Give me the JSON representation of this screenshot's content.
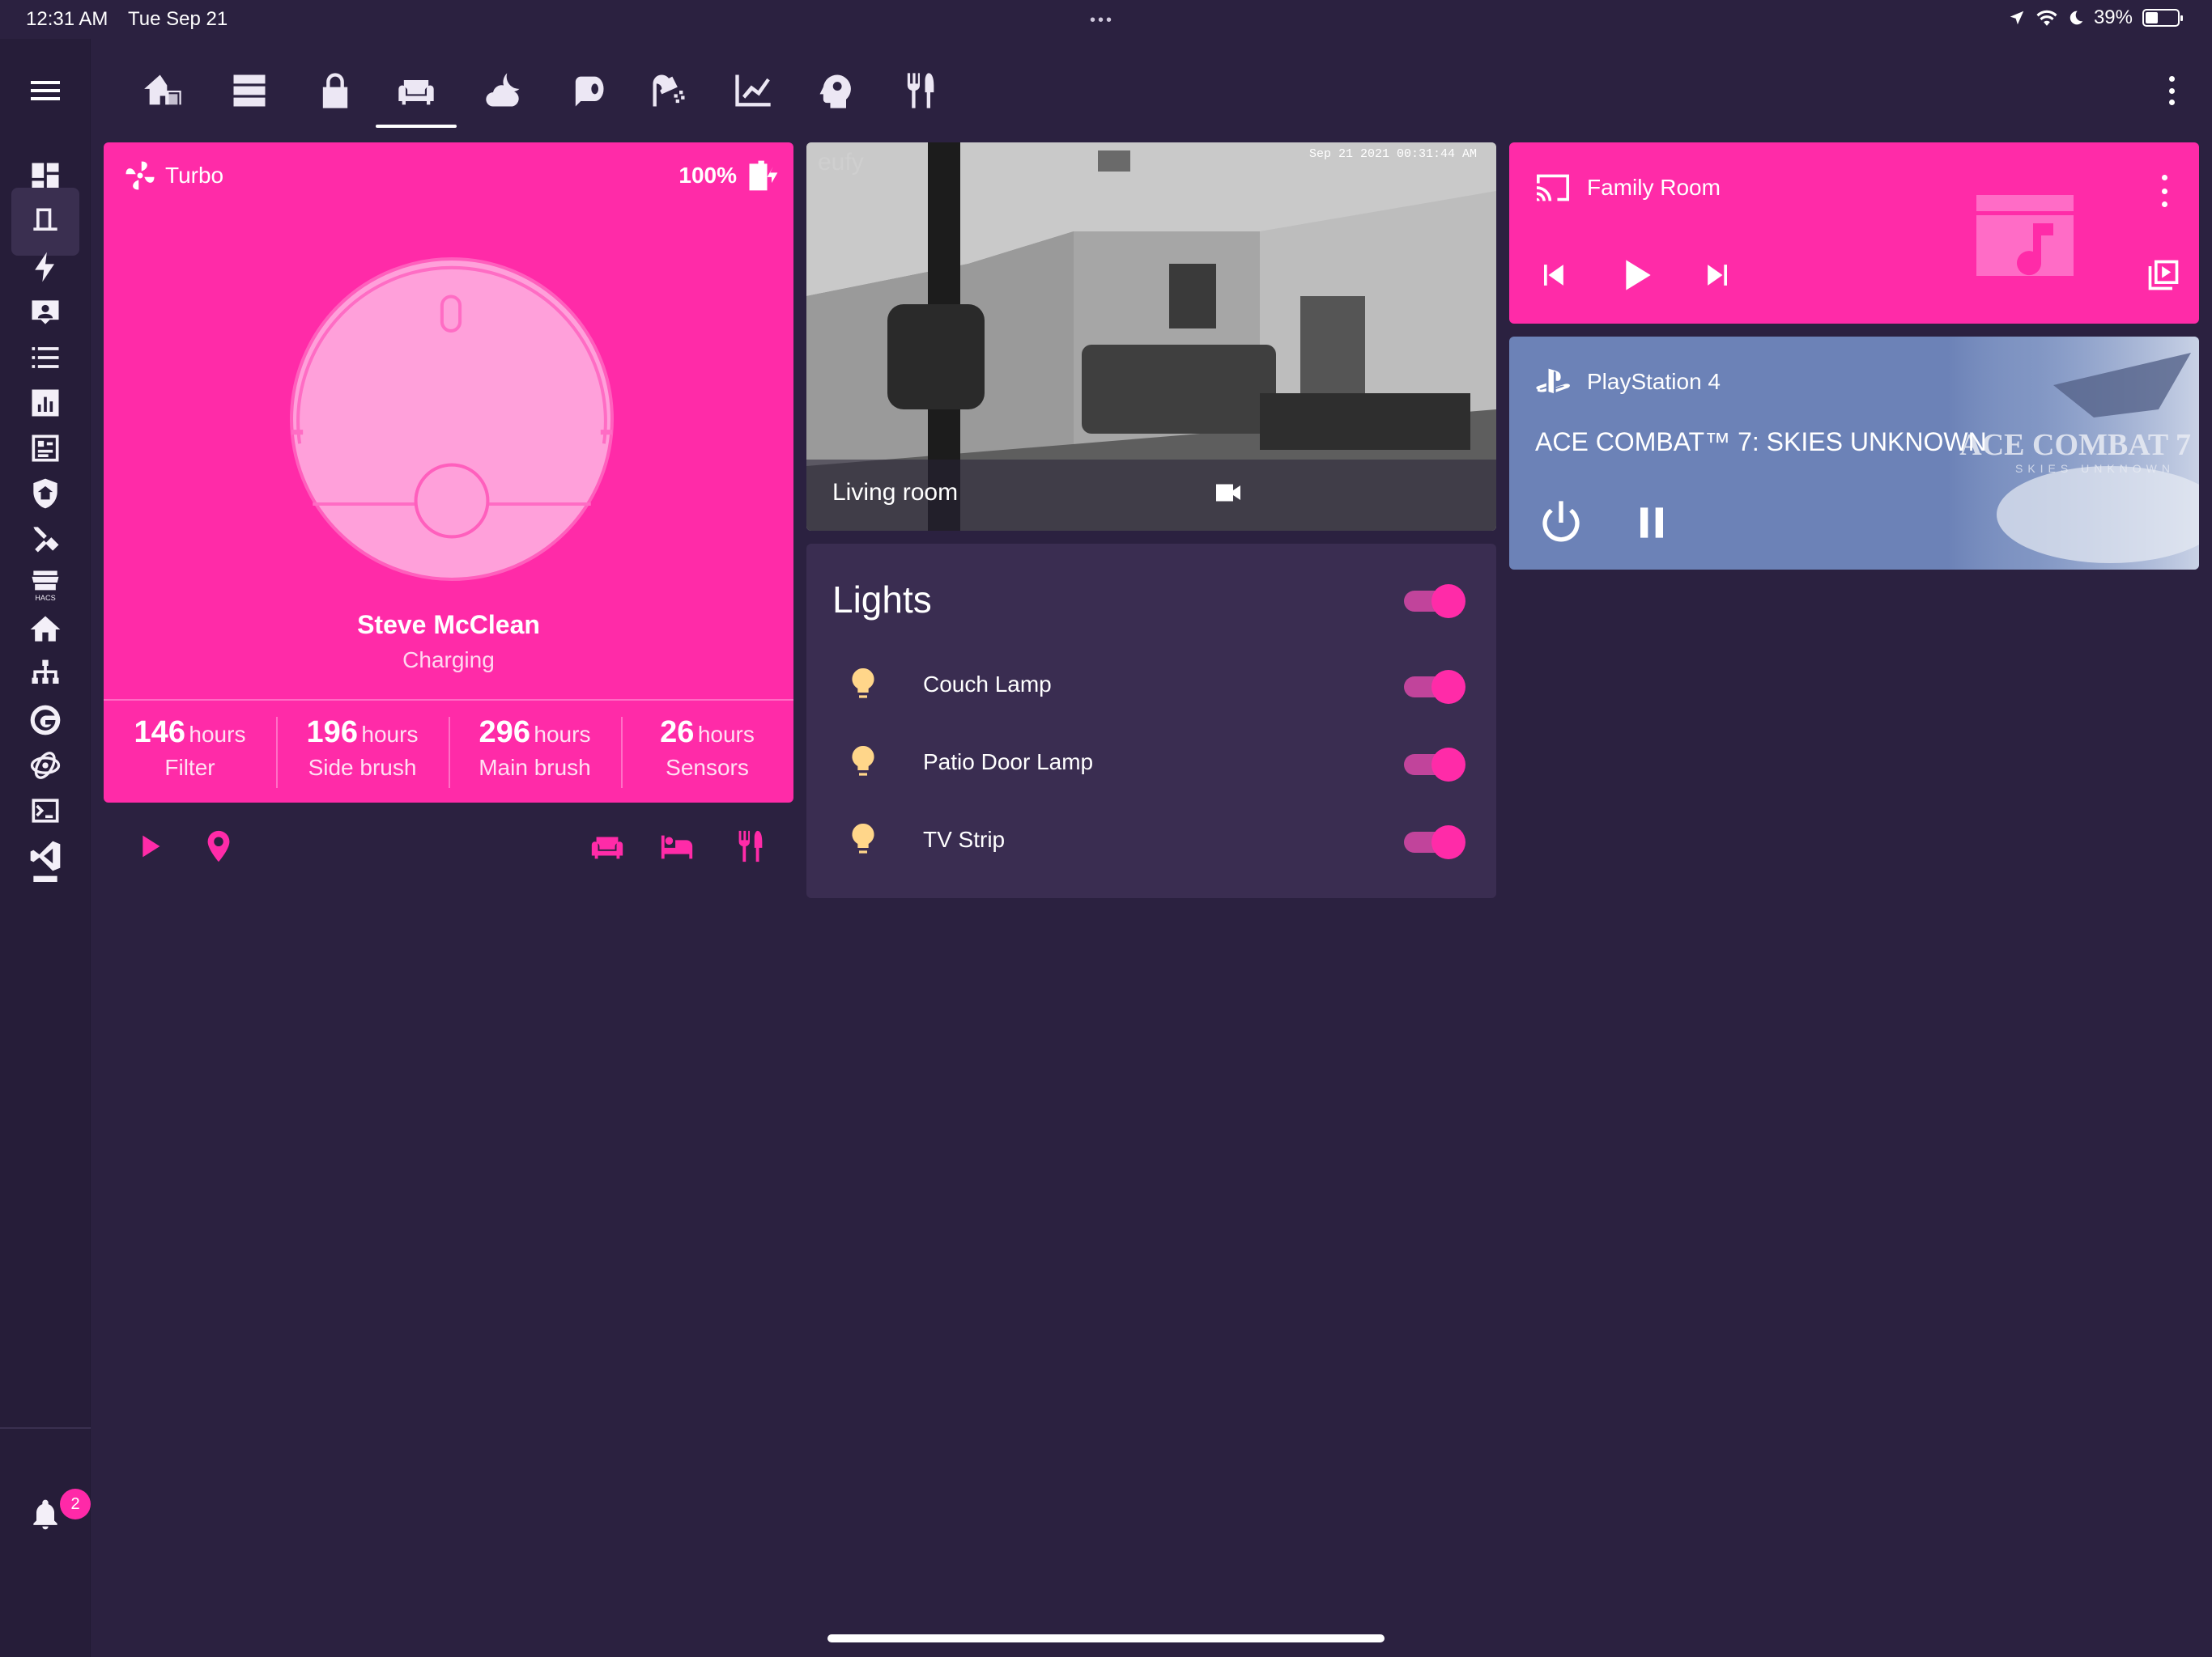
{
  "status_bar": {
    "time": "12:31 AM",
    "date": "Tue Sep 21",
    "battery_percent": "39%",
    "battery_level": 0.39
  },
  "sidebar": {
    "items": [
      {
        "icon": "dashboard-icon"
      },
      {
        "icon": "vacuum-panel-icon",
        "active": true
      },
      {
        "icon": "energy-icon"
      },
      {
        "icon": "person-icon"
      },
      {
        "icon": "list-icon"
      },
      {
        "icon": "history-icon"
      },
      {
        "icon": "logbook-icon"
      },
      {
        "icon": "shield-home-icon"
      },
      {
        "icon": "tools-icon"
      },
      {
        "icon": "hacs-icon",
        "label": "HACS"
      },
      {
        "icon": "home-icon"
      },
      {
        "icon": "network-icon"
      },
      {
        "icon": "gitlab-icon"
      },
      {
        "icon": "atom-icon"
      },
      {
        "icon": "terminal-icon"
      },
      {
        "icon": "vscode-icon"
      }
    ],
    "notifications_count": "2"
  },
  "top_tabs": [
    {
      "icon": "home-floor-icon"
    },
    {
      "icon": "server-icon"
    },
    {
      "icon": "lock-icon"
    },
    {
      "icon": "sofa-icon",
      "active": true
    },
    {
      "icon": "weather-night-icon"
    },
    {
      "icon": "paper-roll-icon"
    },
    {
      "icon": "shower-icon"
    },
    {
      "icon": "chart-line-icon"
    },
    {
      "icon": "head-gear-icon"
    },
    {
      "icon": "silverware-icon"
    }
  ],
  "vacuum": {
    "fan_mode": "Turbo",
    "battery": "100%",
    "name": "Steve McClean",
    "status": "Charging",
    "stats": [
      {
        "value": "146",
        "unit": "hours",
        "label": "Filter"
      },
      {
        "value": "196",
        "unit": "hours",
        "label": "Side brush"
      },
      {
        "value": "296",
        "unit": "hours",
        "label": "Main brush"
      },
      {
        "value": "26",
        "unit": "hours",
        "label": "Sensors"
      }
    ]
  },
  "camera": {
    "brand_logo": "eufy",
    "timestamp": "Sep 21 2021   00:31:44 AM",
    "name": "Living room"
  },
  "lights": {
    "title": "Lights",
    "all_on": true,
    "items": [
      {
        "name": "Couch Lamp",
        "on": true
      },
      {
        "name": "Patio Door Lamp",
        "on": true
      },
      {
        "name": "TV Strip",
        "on": true
      }
    ]
  },
  "media_player": {
    "name": "Family Room"
  },
  "playstation": {
    "name": "PlayStation 4",
    "game": "ACE COMBAT™ 7: SKIES UNKNOWN",
    "art_title": "ACE COMBAT 7",
    "art_subtitle": "SKIES UNKNOWN"
  },
  "colors": {
    "accent": "#ff2ba8",
    "background": "#2b2140",
    "card": "#3a2d51",
    "playstation_card": "#6c82b7"
  }
}
